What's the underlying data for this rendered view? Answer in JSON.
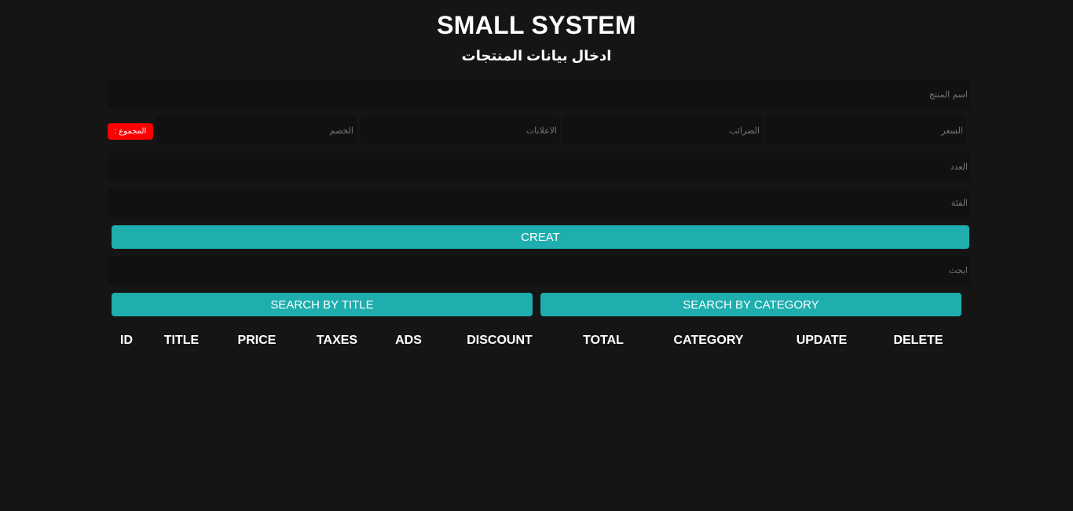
{
  "header": {
    "title": "SMALL SYSTEM",
    "subtitle": "ادخال بيانات المنتجات"
  },
  "form": {
    "title_placeholder": "اسم المنتج",
    "price_placeholder": "السعر",
    "taxes_placeholder": "الضرائب",
    "ads_placeholder": "الاعلانات",
    "discount_placeholder": "الخصم",
    "total_label": "المجموع :",
    "count_placeholder": "العدد",
    "category_placeholder": "الفئة",
    "create_label": "creat"
  },
  "search": {
    "placeholder": "ابحث",
    "by_title_label": "search by title",
    "by_category_label": "search by category"
  },
  "table": {
    "headers": [
      "ID",
      "TITLE",
      "PRICE",
      "TAXES",
      "ADS",
      "DISCOUNT",
      "TOTAL",
      "CATEGORY",
      "UPDATE",
      "DELETE"
    ]
  },
  "colors": {
    "background": "#151515",
    "input_background": "#111111",
    "accent": "#1eaeae",
    "total_badge": "#ff0000"
  }
}
